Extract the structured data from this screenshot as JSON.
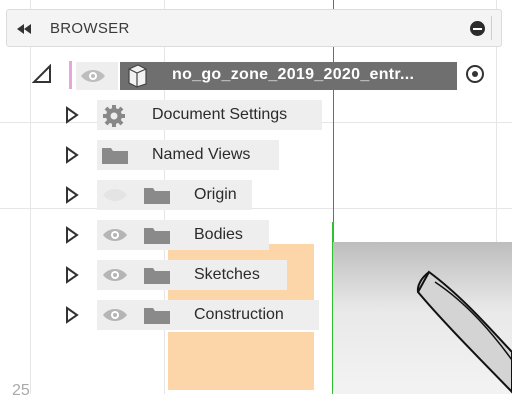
{
  "header": {
    "title": "BROWSER",
    "collapse_icon": "double-chevron-left-icon",
    "pin_icon": "minus-circle-icon"
  },
  "tree": {
    "root": {
      "label": "no_go_zone_2019_2020_entr...",
      "icons": [
        "expanded-triangle-icon",
        "eye-icon",
        "component-icon",
        "activate-radio-icon"
      ]
    },
    "items": [
      {
        "label": "Document Settings",
        "icon": "gear-icon",
        "visibility_icon": ""
      },
      {
        "label": "Named Views",
        "icon": "folder-icon",
        "visibility_icon": ""
      },
      {
        "label": "Origin",
        "icon": "folder-icon",
        "visibility_icon": "hidden-eye-icon"
      },
      {
        "label": "Bodies",
        "icon": "folder-icon",
        "visibility_icon": "eye-icon"
      },
      {
        "label": "Sketches",
        "icon": "folder-icon",
        "visibility_icon": "eye-icon"
      },
      {
        "label": "Construction",
        "icon": "folder-icon",
        "visibility_icon": "eye-icon"
      }
    ]
  },
  "canvas": {
    "corner_number": "25",
    "axis_colors": {
      "x": "#e23b3b",
      "y": "#2fbf2f"
    },
    "highlight_color": "#fcd5a9"
  }
}
